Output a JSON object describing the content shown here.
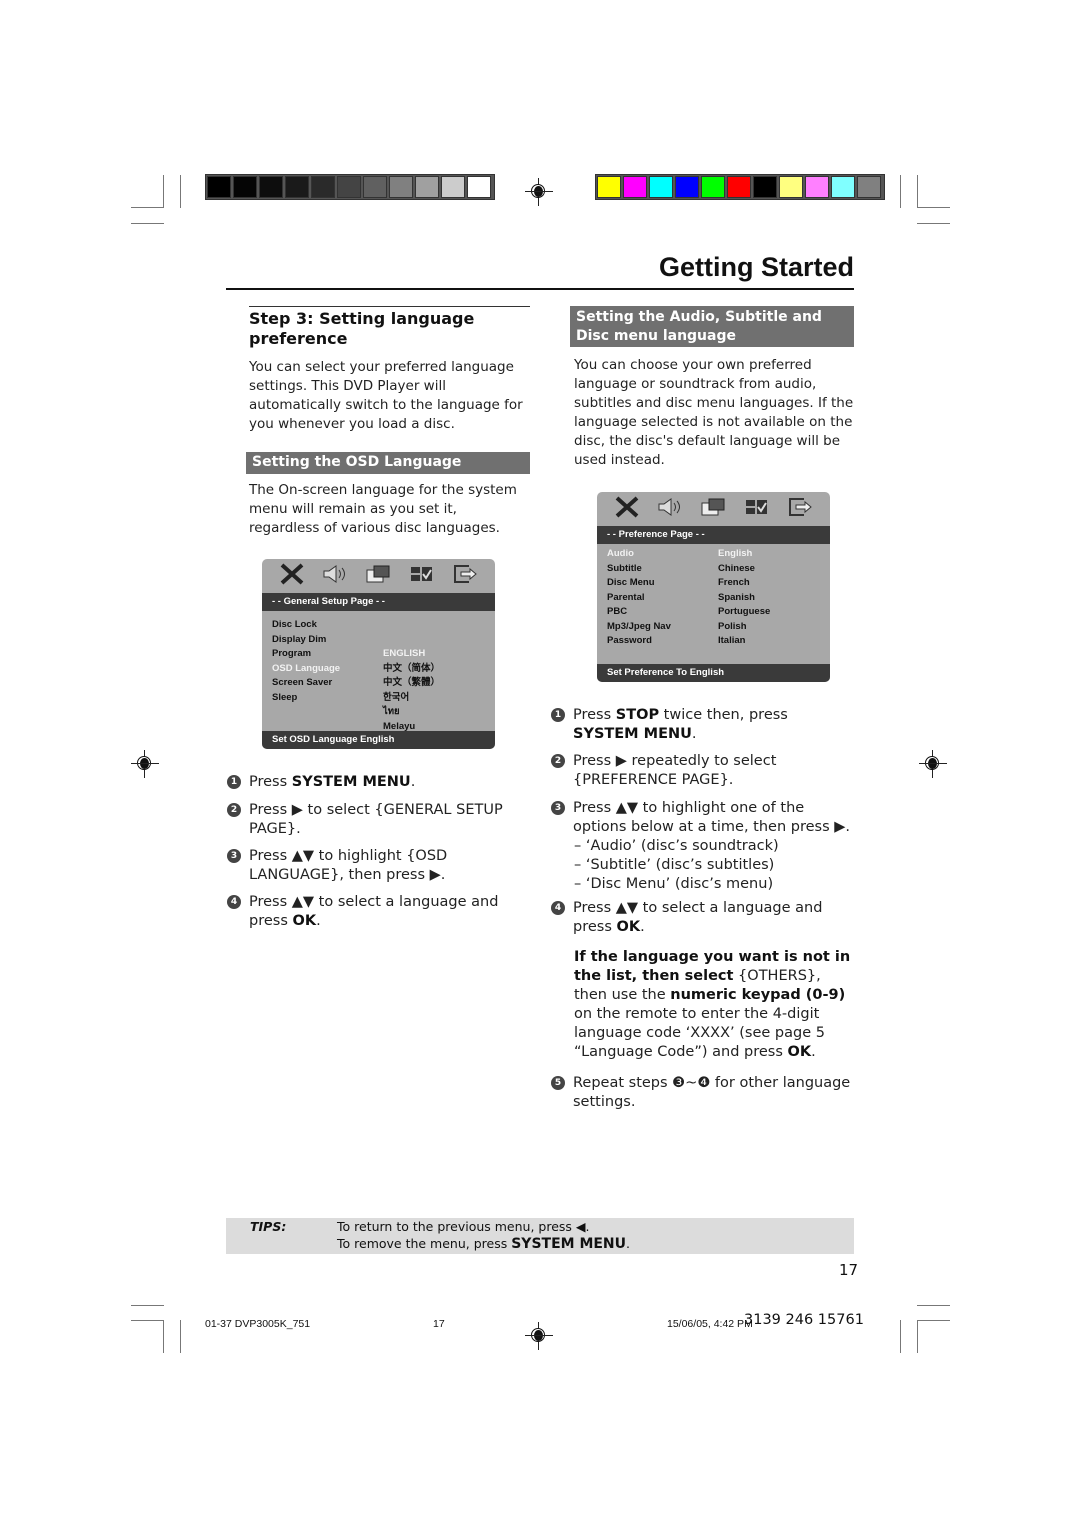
{
  "print_marks": {
    "grayscale_swatches": [
      "#000000",
      "#050505",
      "#0d0d0d",
      "#1a1a1a",
      "#2a2a2a",
      "#444444",
      "#606060",
      "#808080",
      "#a0a0a0",
      "#cccccc",
      "#ffffff"
    ],
    "color_swatches": [
      "#ffff00",
      "#ff00ff",
      "#00ffff",
      "#0000ff",
      "#00ff00",
      "#ff0000",
      "#000000",
      "#ffff80",
      "#ff80ff",
      "#80ffff",
      "#808080"
    ]
  },
  "header": {
    "title": "Getting Started"
  },
  "left": {
    "step_heading": "Step 3:  Setting language preference",
    "intro": "You can select your preferred language settings. This DVD Player will automatically switch to the language for you whenever you load a disc.",
    "section_bar": "Setting the OSD Language",
    "section_text": "The On-screen language for the system menu will remain as you set it, regardless of various disc languages.",
    "osd_menu": {
      "icons": [
        "tools-icon",
        "speaker-icon",
        "video-icon",
        "preference-icon",
        "exit-icon"
      ],
      "header": "- -   General Setup Page   - -",
      "items": [
        "Disc Lock",
        "Display Dim",
        "Program",
        "OSD Language",
        "Screen Saver",
        "Sleep"
      ],
      "selected_item": "OSD Language",
      "options": [
        "ENGLISH",
        "中文（简体）",
        "中文（繁體）",
        "한국어",
        "ไทย",
        "Melayu"
      ],
      "selected_option": "ENGLISH",
      "footer": "Set OSD Language English"
    },
    "steps": [
      {
        "n": "1",
        "parts": [
          [
            "Press ",
            ""
          ],
          [
            "SYSTEM MENU",
            "b"
          ],
          [
            ".",
            ""
          ]
        ]
      },
      {
        "n": "2",
        "parts": [
          [
            "Press ▶ to select {GENERAL SETUP PAGE}.",
            ""
          ]
        ]
      },
      {
        "n": "3",
        "parts": [
          [
            "Press ▲▼ to highlight {OSD LANGUAGE}, then press ▶.",
            ""
          ]
        ]
      },
      {
        "n": "4",
        "parts": [
          [
            "Press ▲▼  to select a language and press ",
            ""
          ],
          [
            "OK",
            "b"
          ],
          [
            ".",
            ""
          ]
        ]
      }
    ]
  },
  "right": {
    "section_bar": "Setting the Audio, Subtitle and Disc menu language",
    "intro": "You can choose your own preferred language or soundtrack from audio, subtitles and disc menu languages. If the language selected is not available on the disc, the disc's default language will be used instead.",
    "osd_menu": {
      "icons": [
        "tools-icon",
        "speaker-icon",
        "video-icon",
        "preference-icon",
        "exit-icon"
      ],
      "header": "- -   Preference Page   - -",
      "items": [
        "Audio",
        "Subtitle",
        "Disc Menu",
        "Parental",
        "PBC",
        "Mp3/Jpeg Nav",
        "Password"
      ],
      "selected_item": "Audio",
      "options": [
        "English",
        "Chinese",
        "French",
        "Spanish",
        "Portuguese",
        "Polish",
        "Italian"
      ],
      "selected_option": "English",
      "footer": "Set Preference To English"
    },
    "steps": [
      {
        "n": "1",
        "parts": [
          [
            "Press ",
            ""
          ],
          [
            "STOP",
            "b"
          ],
          [
            " twice then, press ",
            ""
          ],
          [
            "SYSTEM MENU",
            "b"
          ],
          [
            ".",
            ""
          ]
        ]
      },
      {
        "n": "2",
        "parts": [
          [
            "Press ▶ repeatedly to select {PREFERENCE PAGE}.",
            ""
          ]
        ]
      },
      {
        "n": "3",
        "parts": [
          [
            "Press ▲▼  to highlight one of the options below at a time, then press ▶.",
            ""
          ]
        ]
      },
      {
        "n": "4",
        "parts": [
          [
            "Press ▲▼  to select a language and press ",
            ""
          ],
          [
            "OK",
            "b"
          ],
          [
            ".",
            ""
          ]
        ]
      },
      {
        "n": "5",
        "parts": [
          [
            "Repeat steps ❸~❹ for other language settings.",
            ""
          ]
        ]
      }
    ],
    "options_list": [
      "–  ‘Audio’ (disc’s soundtrack)",
      "–  ‘Subtitle’ (disc’s subtitles)",
      "–  ‘Disc Menu’ (disc’s menu)"
    ],
    "note_bold": "If the language you want is not in the list, then select",
    "note_others": " {OTHERS},",
    "note_line2_a": "then use the ",
    "note_line2_b": "numeric keypad (0-9)",
    "note_line2_c": " on the remote to enter the 4-digit language code ‘XXXX’ (see page 5 “Language Code”) and press ",
    "note_ok": "OK",
    "note_end": "."
  },
  "tips": {
    "label": "TIPS:",
    "line1": "To return to the previous menu, press ◀.",
    "line2_a": "To remove the menu, press ",
    "line2_b": "SYSTEM MENU",
    "line2_c": "."
  },
  "page_number": "17",
  "footer": {
    "file": "01-37 DVP3005K_751",
    "page": "17",
    "date": "15/06/05, 4:42 PM",
    "code": "3139 246 15761"
  }
}
